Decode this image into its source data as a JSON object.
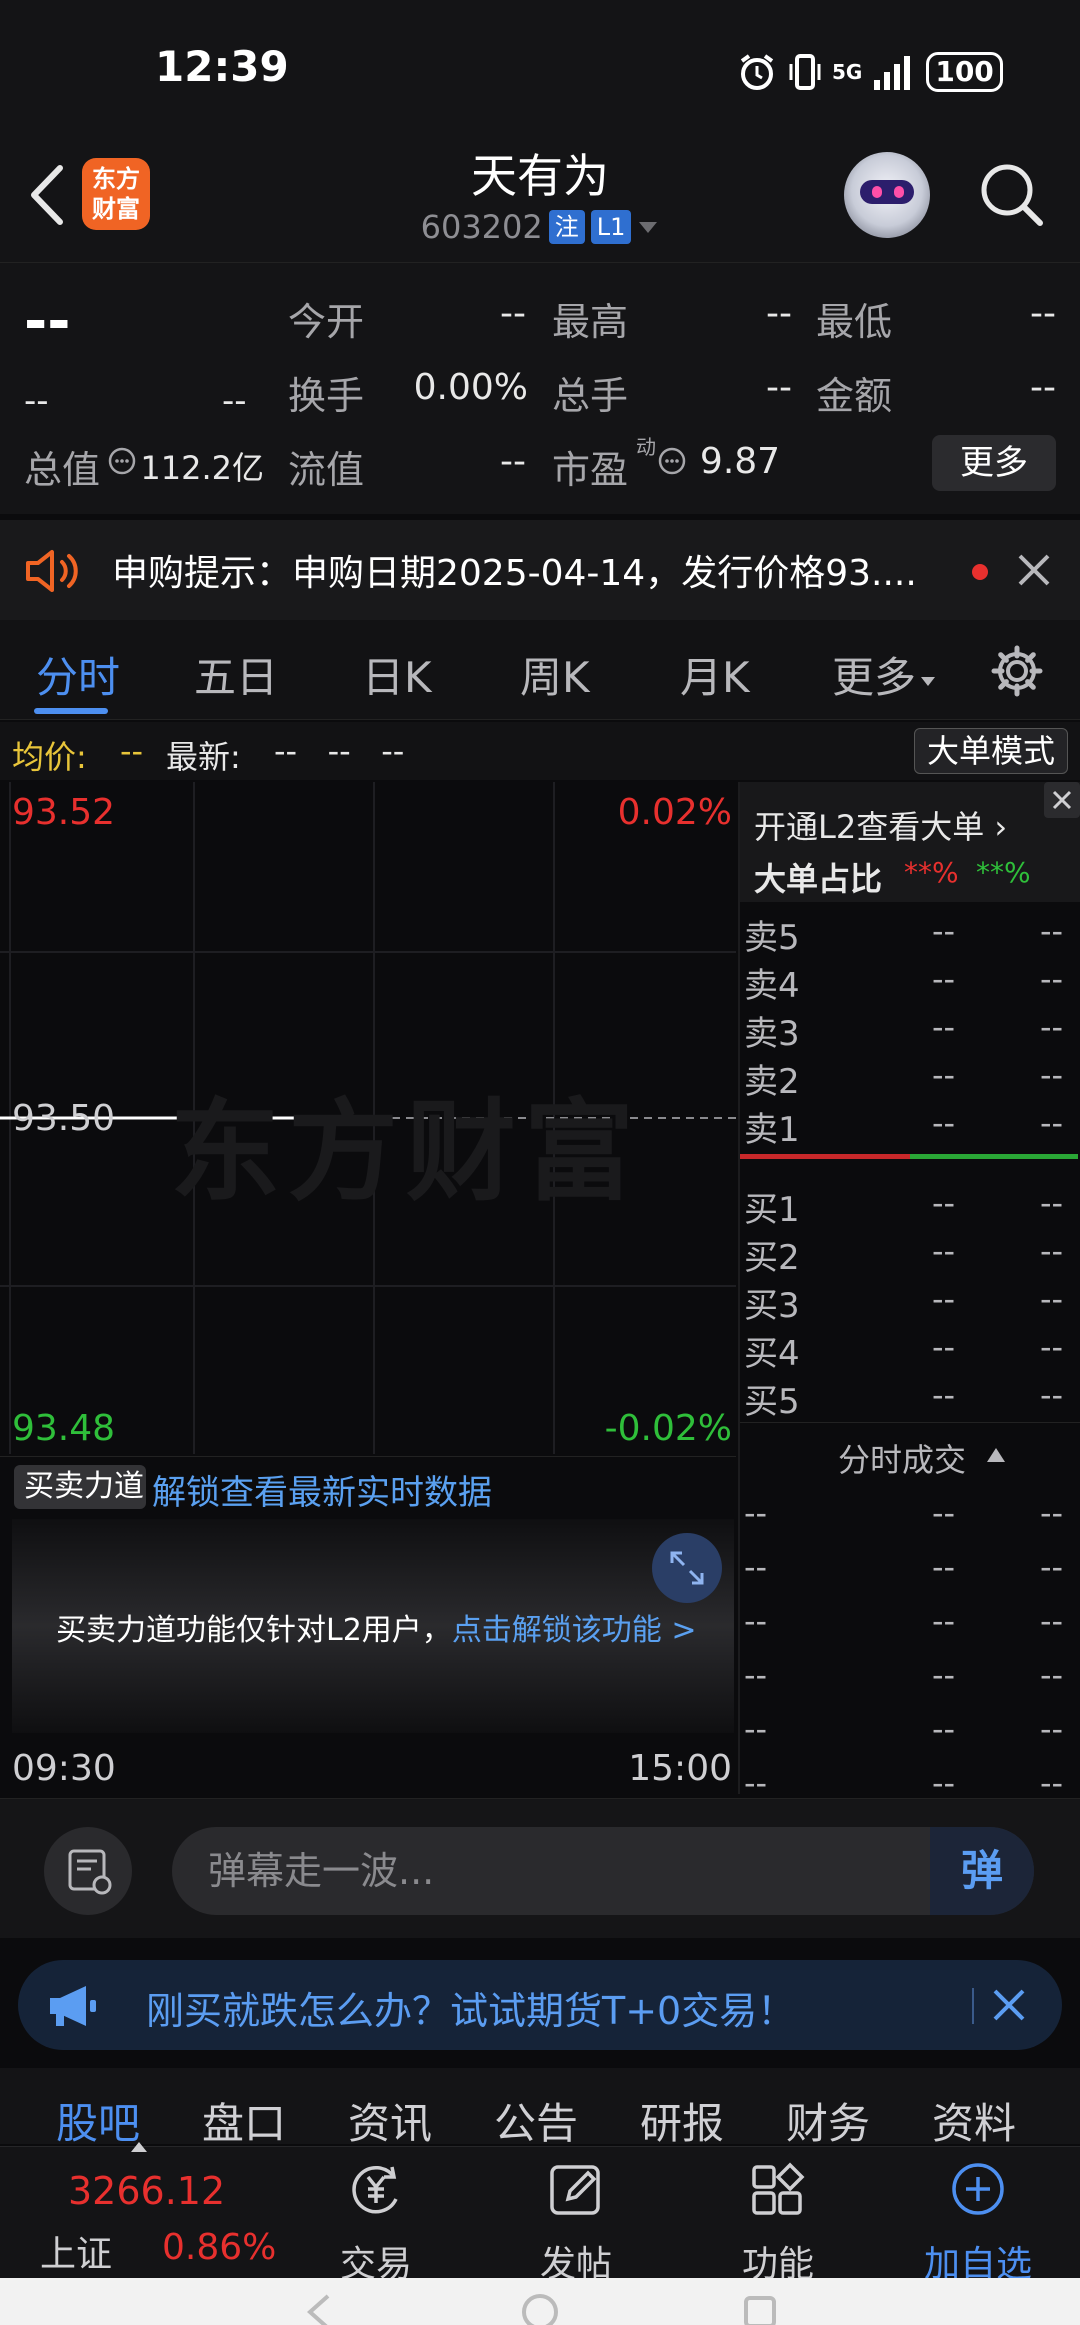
{
  "status_bar": {
    "time": "12:39",
    "network": "5G",
    "battery": "100"
  },
  "header": {
    "title": "天有为",
    "code": "603202",
    "tag_registration": "注",
    "tag_level": "L1",
    "logo_line1": "东方",
    "logo_line2": "财富"
  },
  "quote": {
    "price": "--",
    "change": "--",
    "change_pct": "--",
    "open_label": "今开",
    "open_value": "--",
    "high_label": "最高",
    "high_value": "--",
    "low_label": "最低",
    "low_value": "--",
    "turnover_label": "换手",
    "turnover_value": "0.00%",
    "volume_label": "总手",
    "volume_value": "--",
    "amount_label": "金额",
    "amount_value": "--",
    "mktcap_label": "总值",
    "mktcap_value": "112.2亿",
    "float_label": "流值",
    "float_value": "--",
    "pe_label": "市盈",
    "pe_sup": "动",
    "pe_value": "9.87",
    "more_label": "更多"
  },
  "notice": {
    "text": "申购提示：申购日期2025-04-14，发行价格93...."
  },
  "chart_tabs": [
    "分时",
    "五日",
    "日K",
    "周K",
    "月K",
    "更多"
  ],
  "info_row": {
    "avg_label": "均价:",
    "avg_value": "--",
    "latest_label": "最新:",
    "latest_values": "--   --   --",
    "big_order_mode": "大单模式"
  },
  "chart_data": {
    "type": "line",
    "y_top": "93.52",
    "y_mid": "93.50",
    "y_bottom": "93.48",
    "pct_top": "0.02%",
    "pct_bottom": "-0.02%",
    "x_start": "09:30",
    "x_end": "15:00",
    "ylim": [
      93.48,
      93.52
    ],
    "series": [
      {
        "values": [
          93.5,
          93.5
        ]
      }
    ]
  },
  "l2": {
    "open_label": "开通L2查看大单",
    "ratio_label": "大单占比",
    "ratio_red": "**%",
    "ratio_green": "**%",
    "sell": [
      "卖5",
      "卖4",
      "卖3",
      "卖2",
      "卖1"
    ],
    "buy": [
      "买1",
      "买2",
      "买3",
      "买4",
      "买5"
    ],
    "placeholder": "--",
    "trades_title": "分时成交"
  },
  "power": {
    "select_label": "买卖力道",
    "unlock_text": "解锁查看最新实时数据",
    "msg": "买卖力道功能仅针对L2用户，",
    "msg_link": "点击解锁该功能 >"
  },
  "comment": {
    "placeholder": "弹幕走一波...",
    "danmu_label": "弹"
  },
  "promo": {
    "text": "刚买就跌怎么办？试试期货T+0交易！"
  },
  "bottom_tabs": [
    "股吧",
    "盘口",
    "资讯",
    "公告",
    "研报",
    "财务",
    "资料"
  ],
  "index": {
    "value": "3266.12",
    "name": "上证",
    "pct": "0.86%"
  },
  "bottom_nav": [
    "交易",
    "发帖",
    "功能",
    "加自选"
  ],
  "watermark": "东方财富",
  "colors": {
    "accent": "#4d8ff0",
    "up": "#e8302e",
    "down": "#2fbf3a",
    "orange": "#f06424"
  }
}
